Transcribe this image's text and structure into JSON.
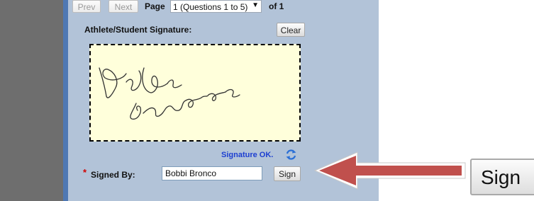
{
  "pager": {
    "prev_label": "Prev",
    "next_label": "Next",
    "page_label": "Page",
    "page_value": "1 (Questions 1 to 5)",
    "of_label": "of 1"
  },
  "signature": {
    "title": "Athlete/Student Signature:",
    "clear_label": "Clear",
    "status_text": "Signature OK.",
    "status_icon": "refresh-icon"
  },
  "signed_by": {
    "required_mark": "*",
    "label": "Signed By:",
    "value": "Bobbi Bronco",
    "sign_label": "Sign"
  },
  "callout": {
    "zoom_label": "Sign",
    "arrow_color": "#c0504d"
  }
}
